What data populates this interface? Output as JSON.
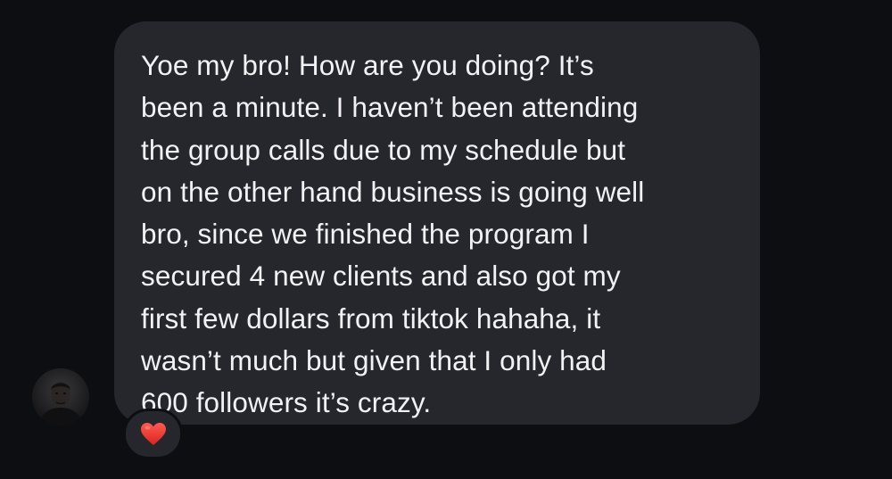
{
  "conversation": {
    "message": {
      "lines": [
        "Yoe my bro! How are you doing? It’s",
        "been a minute. I haven’t been attending",
        "the group calls due to my schedule but",
        "on the other hand business is going well",
        "bro, since we finished the program I",
        "secured 4 new clients and also got my",
        "first few dollars from tiktok hahaha, it",
        "wasn’t much but given that I only had",
        "600 followers it’s crazy."
      ],
      "reaction_icon": "red-heart-icon"
    },
    "sender_avatar_icon": "avatar-photo"
  },
  "colors": {
    "background": "#0d0e12",
    "bubble": "#26272d",
    "text": "#f2f2f4",
    "heart": "#e8312e"
  }
}
